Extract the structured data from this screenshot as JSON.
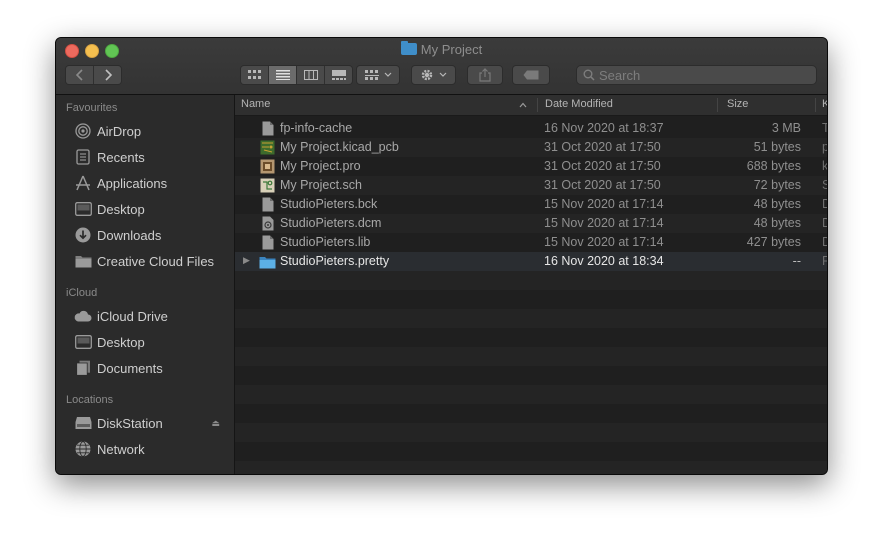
{
  "window": {
    "title": "My Project"
  },
  "toolbar": {
    "search_placeholder": "Search"
  },
  "sidebar": {
    "sections": [
      {
        "label": "Favourites",
        "items": [
          {
            "label": "AirDrop",
            "icon": "airdrop-icon"
          },
          {
            "label": "Recents",
            "icon": "recents-icon"
          },
          {
            "label": "Applications",
            "icon": "applications-icon"
          },
          {
            "label": "Desktop",
            "icon": "desktop-icon"
          },
          {
            "label": "Downloads",
            "icon": "downloads-icon"
          },
          {
            "label": "Creative Cloud Files",
            "icon": "folder-icon"
          }
        ]
      },
      {
        "label": "iCloud",
        "items": [
          {
            "label": "iCloud Drive",
            "icon": "cloud-icon"
          },
          {
            "label": "Desktop",
            "icon": "desktop-icon"
          },
          {
            "label": "Documents",
            "icon": "documents-icon"
          }
        ]
      },
      {
        "label": "Locations",
        "items": [
          {
            "label": "DiskStation",
            "icon": "nas-icon"
          },
          {
            "label": "Network",
            "icon": "network-icon"
          }
        ]
      }
    ]
  },
  "columns": {
    "name": "Name",
    "date": "Date Modified",
    "size": "Size",
    "kind": "K"
  },
  "files": [
    {
      "name": "fp-info-cache",
      "date": "16 Nov 2020 at 18:37",
      "size": "3 MB",
      "kind": "T"
    },
    {
      "name": "My Project.kicad_pcb",
      "date": "31 Oct 2020 at 17:50",
      "size": "51 bytes",
      "kind": "p"
    },
    {
      "name": "My Project.pro",
      "date": "31 Oct 2020 at 17:50",
      "size": "688 bytes",
      "kind": "k"
    },
    {
      "name": "My Project.sch",
      "date": "31 Oct 2020 at 17:50",
      "size": "72 bytes",
      "kind": "S"
    },
    {
      "name": "StudioPieters.bck",
      "date": "15 Nov 2020 at 17:14",
      "size": "48 bytes",
      "kind": "D"
    },
    {
      "name": "StudioPieters.dcm",
      "date": "15 Nov 2020 at 17:14",
      "size": "48 bytes",
      "kind": "D"
    },
    {
      "name": "StudioPieters.lib",
      "date": "15 Nov 2020 at 17:14",
      "size": "427 bytes",
      "kind": "D"
    },
    {
      "name": "StudioPieters.pretty",
      "date": "16 Nov 2020 at 18:34",
      "size": "--",
      "kind": "F"
    }
  ],
  "colors": {
    "accent": "#3f8ec9",
    "background": "#1f1f1f",
    "sidebar": "#2b2b2b"
  }
}
